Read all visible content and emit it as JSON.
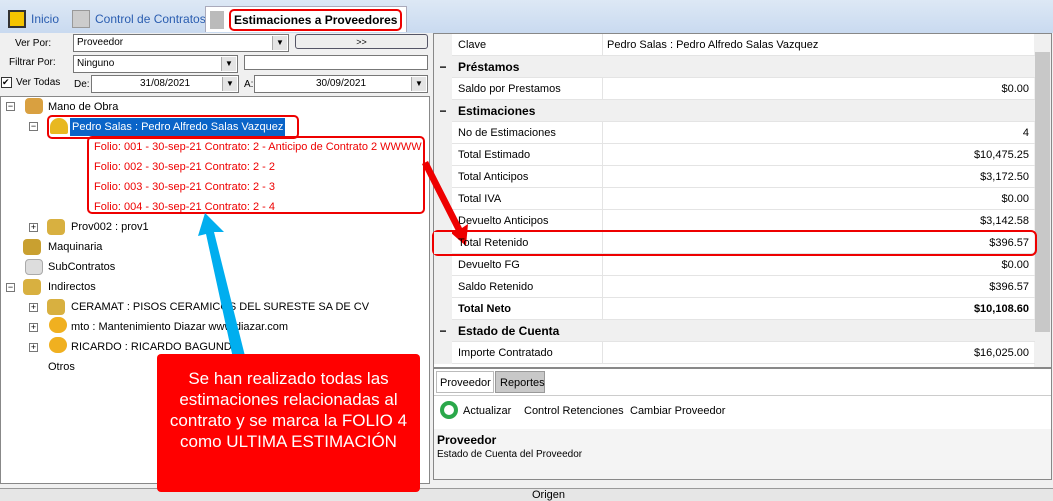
{
  "tabs": [
    {
      "label": "Inicio",
      "icon": "logo-icon"
    },
    {
      "label": "Control de Contratos",
      "icon": "contract-icon"
    },
    {
      "label": "Estimaciones a Proveedores",
      "icon": "estimate-icon",
      "active": true
    }
  ],
  "filters": {
    "ver_por_label": "Ver Por:",
    "ver_por_value": "Proveedor",
    "go_button": ">>",
    "filtrar_label": "Filtrar Por:",
    "filtrar_value": "Ninguno",
    "filtrar_text": "",
    "ver_todas_label": "Ver Todas",
    "ver_todas_checked": true,
    "de_label": "De:",
    "de_value": "31/08/2021",
    "a_label": "A:",
    "a_value": "30/09/2021"
  },
  "tree": {
    "mano_obra": "Mano de Obra",
    "pedro": "Pedro Salas : Pedro Alfredo Salas Vazquez",
    "folios": [
      "Folio: 001 - 30-sep-21 Contrato: 2 -  Anticipo de Contrato 2 WWWW",
      "Folio: 002 - 30-sep-21 Contrato: 2 -  2",
      "Folio: 003 - 30-sep-21 Contrato: 2 -  3",
      "Folio: 004 - 30-sep-21 Contrato: 2 -  4"
    ],
    "prov002": "Prov002 : prov1",
    "maquinaria": "Maquinaria",
    "subcontratos": "SubContratos",
    "indirectos": "Indirectos",
    "ceramat": "CERAMAT : PISOS CERAMICOS DEL SURESTE SA DE CV",
    "mto": "mto : Mantenimiento Diazar www.diazar.com",
    "ricardo": "RICARDO : RICARDO BAGUNDO",
    "otros": "Otros"
  },
  "properties": [
    {
      "name": "Clave",
      "value": "Pedro Salas : Pedro Alfredo Salas Vazquez",
      "left": true
    },
    {
      "category": "Préstamos"
    },
    {
      "name": "Saldo por Prestamos",
      "value": "$0.00"
    },
    {
      "category": "Estimaciones"
    },
    {
      "name": "No de Estimaciones",
      "value": "4"
    },
    {
      "name": "Total Estimado",
      "value": "$10,475.25"
    },
    {
      "name": "Total Anticipos",
      "value": "$3,172.50"
    },
    {
      "name": "Total IVA",
      "value": "$0.00"
    },
    {
      "name": "Devuelto Anticipos",
      "value": "$3,142.58"
    },
    {
      "name": "Total Retenido",
      "value": "$396.57",
      "highlight": true
    },
    {
      "name": "Devuelto FG",
      "value": "$0.00"
    },
    {
      "name": "Saldo Retenido",
      "value": "$396.57"
    },
    {
      "name": "Total Neto",
      "value": "$10,108.60",
      "bold": true
    },
    {
      "category": "Estado de Cuenta"
    },
    {
      "name": "Importe Contratado",
      "value": "$16,025.00"
    }
  ],
  "bottom_tabs": [
    "Proveedor",
    "Reportes"
  ],
  "actions": {
    "actualizar": "Actualizar",
    "control": "Control Retenciones",
    "cambiar": "Cambiar Proveedor"
  },
  "description": {
    "title": "Proveedor",
    "text": "Estado de Cuenta del Proveedor"
  },
  "status": {
    "origen": "Origen"
  },
  "callout": "Se han realizado todas las estimaciones relacionadas al contrato y se marca la FOLIO 4 como ULTIMA ESTIMACIÓN",
  "colors": {
    "annotation_red": "#ff0000",
    "arrow_blue": "#00aeef",
    "selection": "#0a64c8"
  }
}
